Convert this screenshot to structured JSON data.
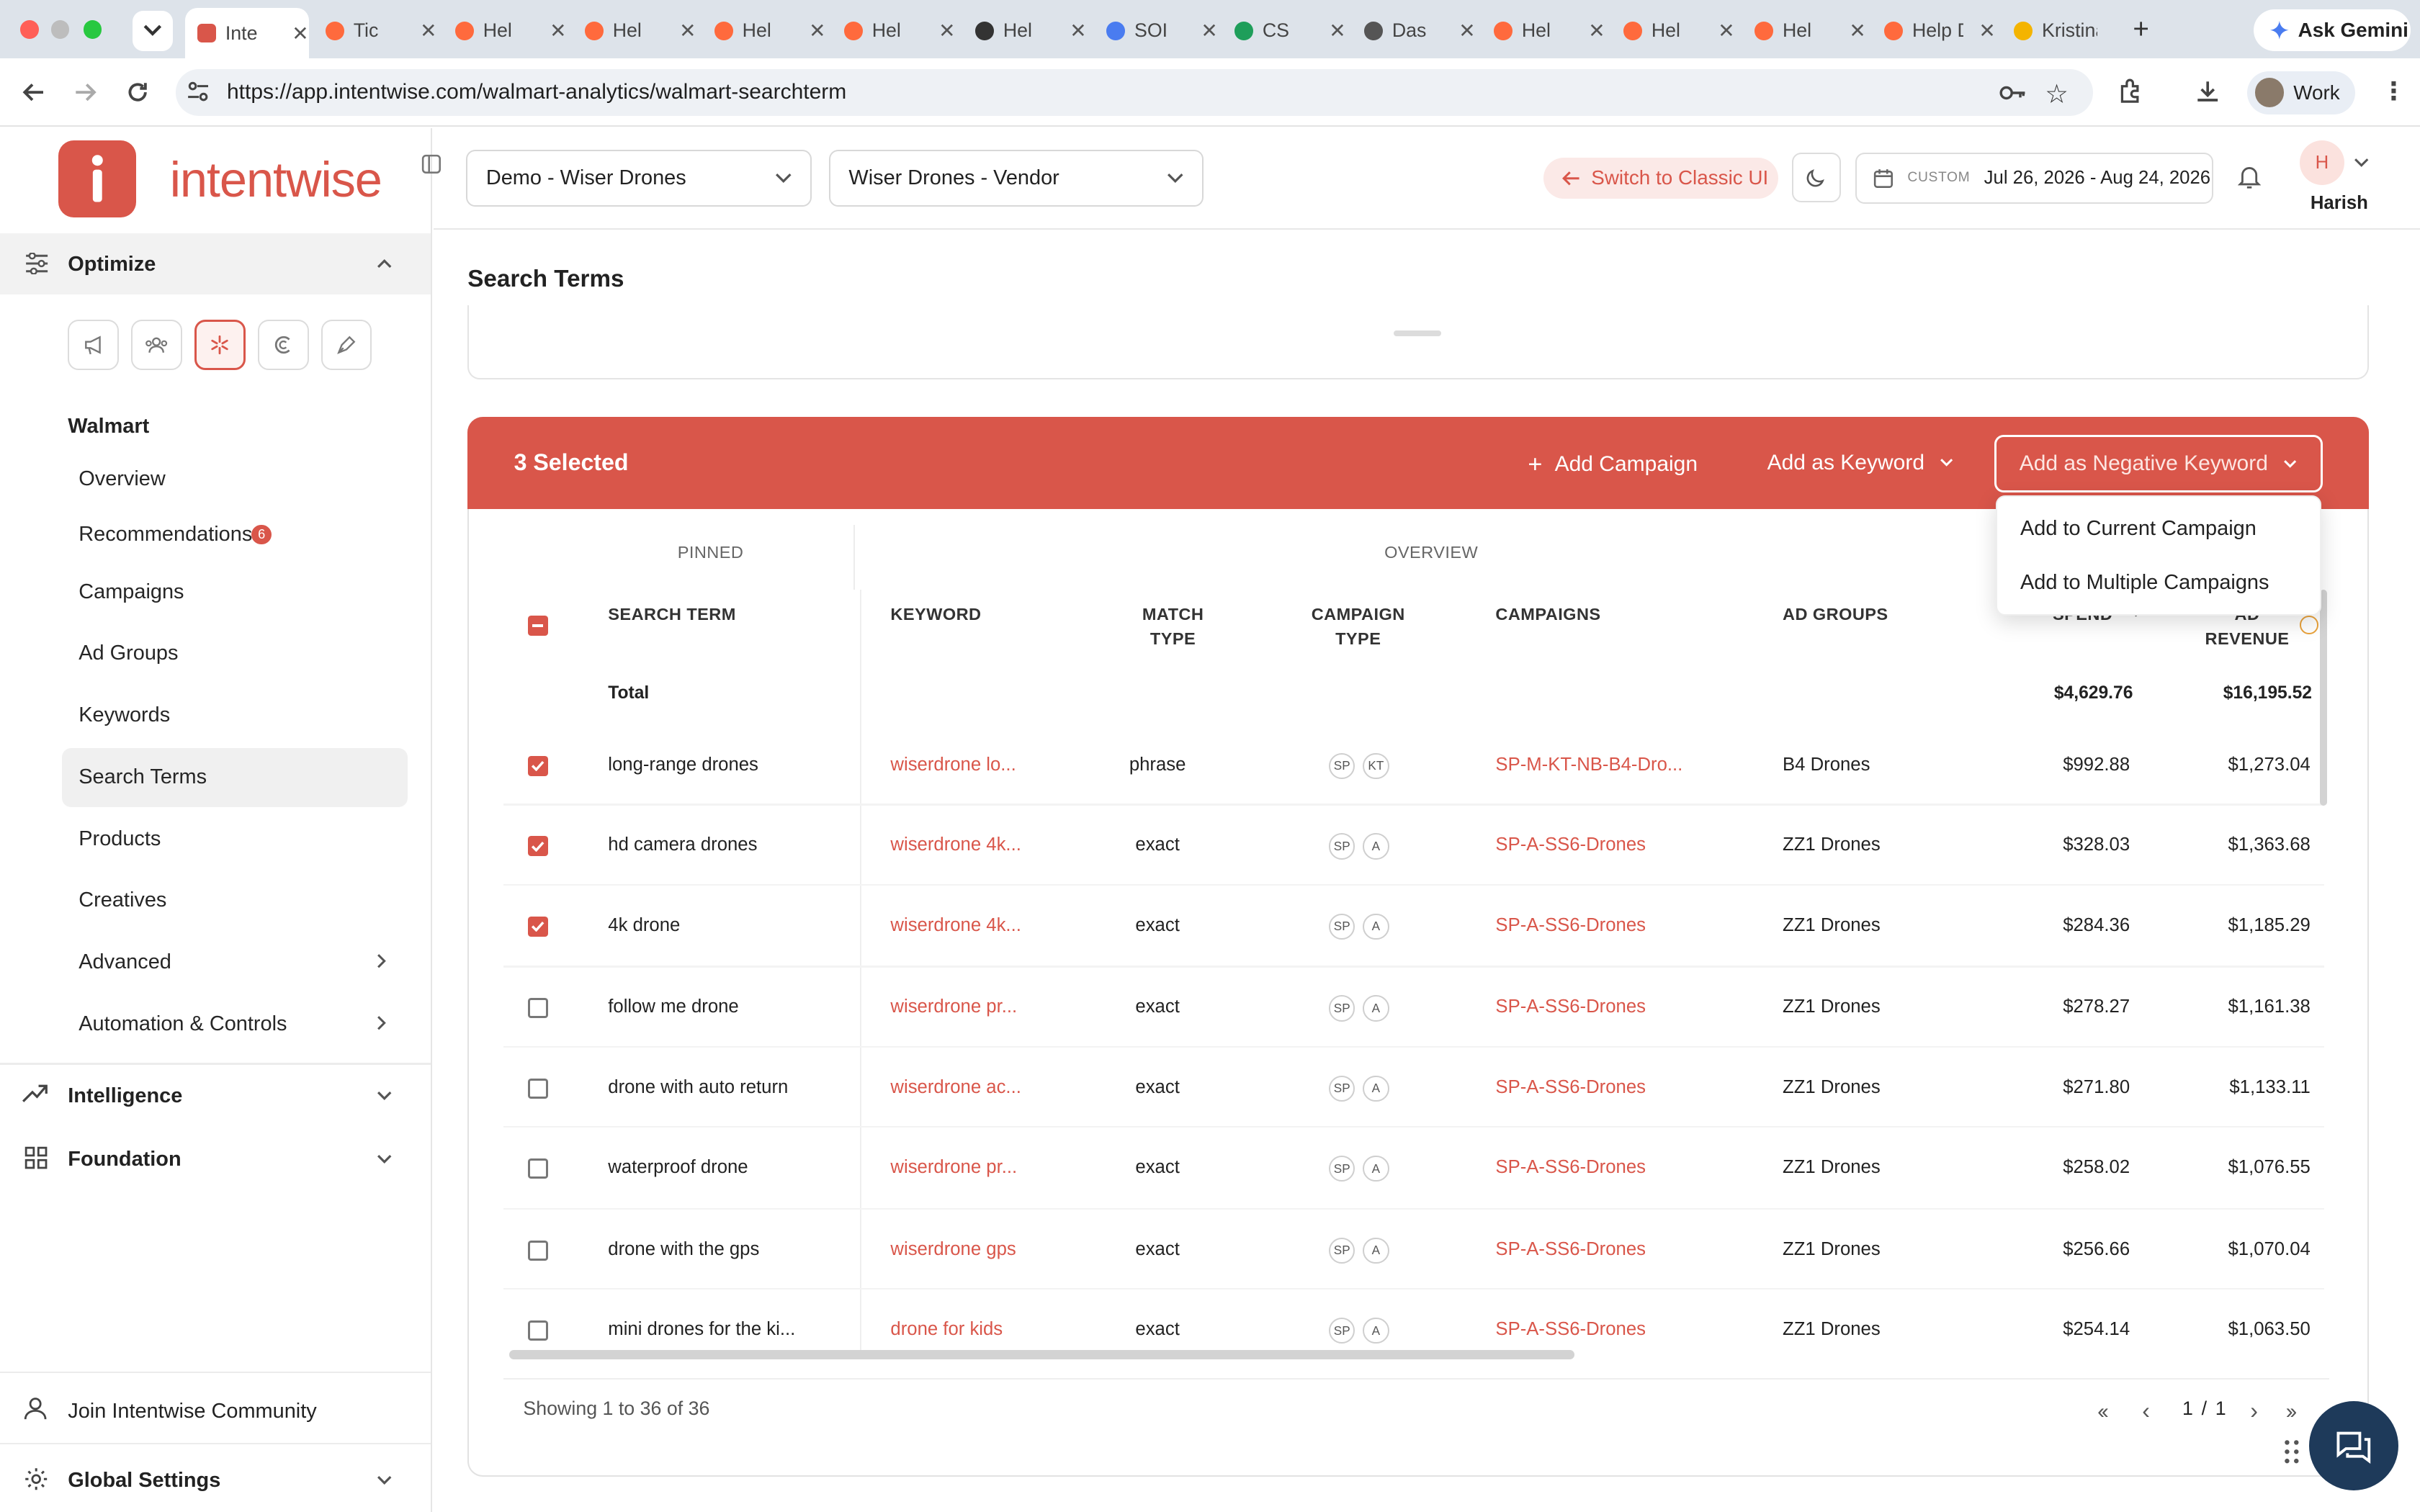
{
  "browser": {
    "tabs": [
      {
        "label": "Inte",
        "icon": "intentwise-favicon",
        "active": true
      },
      {
        "label": "Tic",
        "icon": "hubspot-favicon"
      },
      {
        "label": "Hel",
        "icon": "hubspot-favicon"
      },
      {
        "label": "Hel",
        "icon": "hubspot-favicon"
      },
      {
        "label": "Hel",
        "icon": "hubspot-favicon"
      },
      {
        "label": "Hel",
        "icon": "hubspot-favicon"
      },
      {
        "label": "Hel",
        "icon": "openai-favicon"
      },
      {
        "label": "SOI",
        "icon": "docs-favicon"
      },
      {
        "label": "CS",
        "icon": "sheets-favicon"
      },
      {
        "label": "Das",
        "icon": "globe-favicon"
      },
      {
        "label": "Hel",
        "icon": "hubspot-favicon"
      },
      {
        "label": "Hel",
        "icon": "hubspot-favicon"
      },
      {
        "label": "Hel",
        "icon": "hubspot-favicon"
      },
      {
        "label": "Help De",
        "icon": "hubspot-favicon"
      },
      {
        "label": "Kristina",
        "icon": "drive-favicon"
      }
    ],
    "url": "https://app.intentwise.com/walmart-analytics/walmart-searchterm",
    "ask_gemini": "Ask Gemini",
    "profile": "Work"
  },
  "brand": {
    "name": "intentwise",
    "accent": "#d9564a"
  },
  "sidebar": {
    "optimize": "Optimize",
    "channel": "Walmart",
    "items": [
      {
        "label": "Overview"
      },
      {
        "label": "Recommendations",
        "badge": "6"
      },
      {
        "label": "Campaigns"
      },
      {
        "label": "Ad Groups"
      },
      {
        "label": "Keywords"
      },
      {
        "label": "Search Terms",
        "active": true
      },
      {
        "label": "Products"
      },
      {
        "label": "Creatives"
      },
      {
        "label": "Advanced"
      },
      {
        "label": "Automation & Controls"
      }
    ],
    "intelligence": "Intelligence",
    "foundation": "Foundation",
    "community": "Join Intentwise Community",
    "global_settings": "Global Settings"
  },
  "header": {
    "account": "Demo - Wiser Drones",
    "profile": "Wiser Drones - Vendor",
    "switch_classic": "Switch to Classic UI",
    "date_mode": "CUSTOM",
    "date_range": "Jul 26, 2026 - Aug 24, 2026",
    "user_initial": "H",
    "user_name": "Harish"
  },
  "page": {
    "title": "Search Terms"
  },
  "selection_bar": {
    "count": "3 Selected",
    "add_campaign": "Add Campaign",
    "add_keyword": "Add as Keyword",
    "add_negative": "Add as Negative Keyword"
  },
  "dropdown": {
    "current": "Add to Current Campaign",
    "multiple": "Add to Multiple Campaigns"
  },
  "table": {
    "group_pinned": "PINNED",
    "group_overview": "OVERVIEW",
    "headers": {
      "search_term": "SEARCH TERM",
      "keyword": "KEYWORD",
      "match_type_1": "MATCH",
      "match_type_2": "TYPE",
      "campaign_type_1": "CAMPAIGN",
      "campaign_type_2": "TYPE",
      "campaigns": "CAMPAIGNS",
      "ad_groups": "AD GROUPS",
      "spend": "SPEND",
      "ad_revenue_1": "AD",
      "ad_revenue_2": "REVENUE"
    },
    "total": {
      "label": "Total",
      "spend": "$4,629.76",
      "revenue": "$16,195.52"
    },
    "rows": [
      {
        "checked": true,
        "term": "long-range drones",
        "keyword": "wiserdrone lo...",
        "match": "phrase",
        "pill1": "SP",
        "pill2": "KT",
        "campaign": "SP-M-KT-NB-B4-Dro...",
        "adgroup": "B4 Drones",
        "spend": "$992.88",
        "revenue": "$1,273.04"
      },
      {
        "checked": true,
        "term": "hd camera drones",
        "keyword": "wiserdrone 4k...",
        "match": "exact",
        "pill1": "SP",
        "pill2": "A",
        "campaign": "SP-A-SS6-Drones",
        "adgroup": "ZZ1 Drones",
        "spend": "$328.03",
        "revenue": "$1,363.68"
      },
      {
        "checked": true,
        "term": "4k drone",
        "keyword": "wiserdrone 4k...",
        "match": "exact",
        "pill1": "SP",
        "pill2": "A",
        "campaign": "SP-A-SS6-Drones",
        "adgroup": "ZZ1 Drones",
        "spend": "$284.36",
        "revenue": "$1,185.29"
      },
      {
        "checked": false,
        "term": "follow me drone",
        "keyword": "wiserdrone pr...",
        "match": "exact",
        "pill1": "SP",
        "pill2": "A",
        "campaign": "SP-A-SS6-Drones",
        "adgroup": "ZZ1 Drones",
        "spend": "$278.27",
        "revenue": "$1,161.38"
      },
      {
        "checked": false,
        "term": "drone with auto return",
        "keyword": "wiserdrone ac...",
        "match": "exact",
        "pill1": "SP",
        "pill2": "A",
        "campaign": "SP-A-SS6-Drones",
        "adgroup": "ZZ1 Drones",
        "spend": "$271.80",
        "revenue": "$1,133.11"
      },
      {
        "checked": false,
        "term": "waterproof drone",
        "keyword": "wiserdrone pr...",
        "match": "exact",
        "pill1": "SP",
        "pill2": "A",
        "campaign": "SP-A-SS6-Drones",
        "adgroup": "ZZ1 Drones",
        "spend": "$258.02",
        "revenue": "$1,076.55"
      },
      {
        "checked": false,
        "term": "drone with the gps",
        "keyword": "wiserdrone gps",
        "match": "exact",
        "pill1": "SP",
        "pill2": "A",
        "campaign": "SP-A-SS6-Drones",
        "adgroup": "ZZ1 Drones",
        "spend": "$256.66",
        "revenue": "$1,070.04"
      },
      {
        "checked": false,
        "term": "mini drones for the ki...",
        "keyword": "drone for kids",
        "match": "exact",
        "pill1": "SP",
        "pill2": "A",
        "campaign": "SP-A-SS6-Drones",
        "adgroup": "ZZ1 Drones",
        "spend": "$254.14",
        "revenue": "$1,063.50"
      }
    ]
  },
  "footer": {
    "showing": "Showing 1 to 36 of 36",
    "page": "1 / 1"
  }
}
